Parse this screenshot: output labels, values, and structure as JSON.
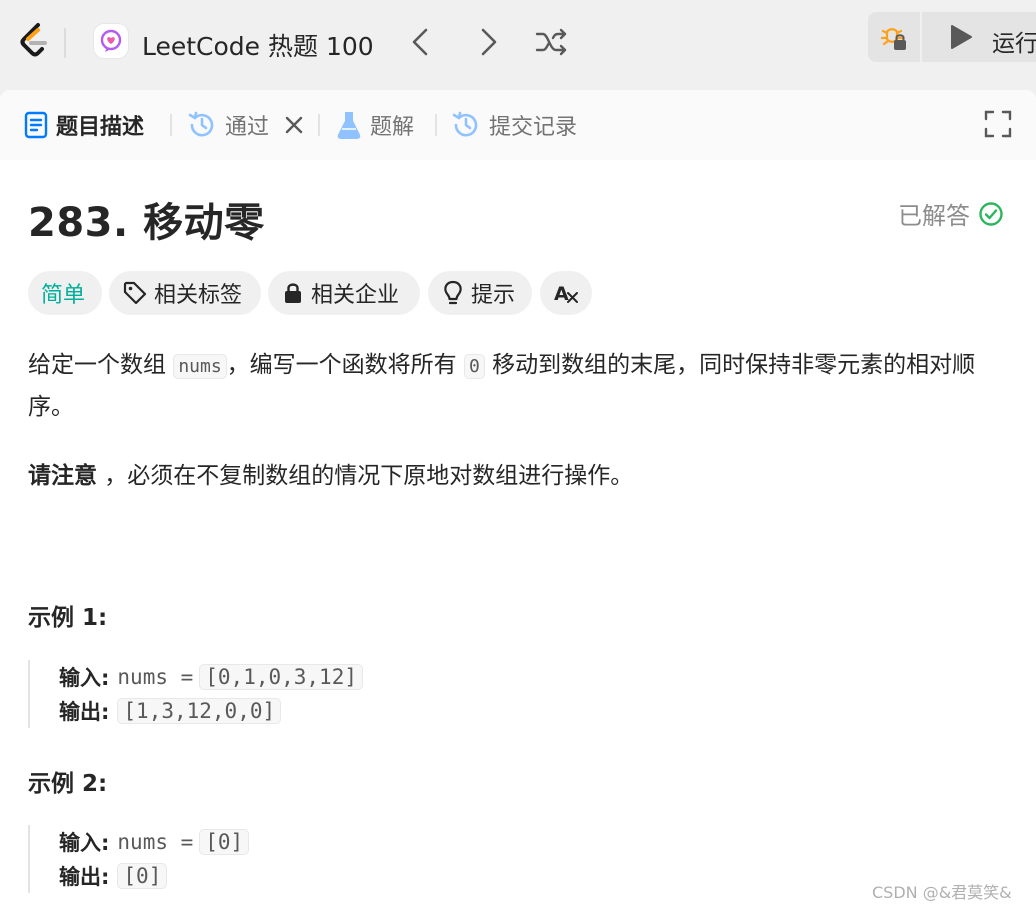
{
  "topbar": {
    "list_title": "LeetCode 热题 100",
    "run_label": "运行"
  },
  "tabs": [
    {
      "label": "题目描述",
      "icon": "description-icon"
    },
    {
      "label": "通过",
      "icon": "history-icon"
    },
    {
      "label": "题解",
      "icon": "flask-icon"
    },
    {
      "label": "提交记录",
      "icon": "history-icon"
    }
  ],
  "problem": {
    "title": "283. 移动零",
    "status": "已解答",
    "tags": {
      "difficulty": "简单",
      "related_tags": "相关标签",
      "companies": "相关企业",
      "hint": "提示",
      "translate": "Aあ"
    },
    "desc_part1": "给定一个数组 ",
    "desc_code1": "nums",
    "desc_part2": "，编写一个函数将所有 ",
    "desc_code2": "0",
    "desc_part3": " 移动到数组的末尾，同时保持非零元素的相对顺序。",
    "note_bold": "请注意",
    "note_rest": " ，必须在不复制数组的情况下原地对数组进行操作。"
  },
  "examples": [
    {
      "heading": "示例 1:",
      "input_label": "输入:",
      "input_prefix": "nums =",
      "input_value": "[0,1,0,3,12]",
      "output_label": "输出:",
      "output_value": "[1,3,12,0,0]"
    },
    {
      "heading": "示例 2:",
      "input_label": "输入:",
      "input_prefix": "nums =",
      "input_value": "[0]",
      "output_label": "输出:",
      "output_value": "[0]"
    }
  ],
  "watermark": "CSDN @&君莫笑&",
  "colors": {
    "easy": "#00af9b",
    "solved_check": "#2db55d",
    "tab_icon_active": "#007aff",
    "tab_icon_inactive": "#8fc2ff",
    "debug_icon": "#ffa116"
  }
}
